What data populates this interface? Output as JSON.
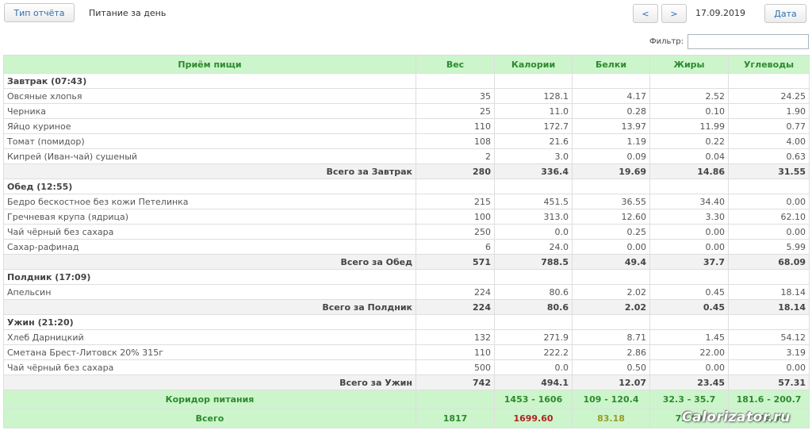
{
  "header": {
    "report_type_button": "Тип отчёта",
    "page_title": "Питание за день",
    "prev_button": "<",
    "next_button": ">",
    "current_date": "17.09.2019",
    "date_button": "Дата",
    "filter_label": "Фильтр:",
    "filter_value": ""
  },
  "table": {
    "columns": [
      "Приём пищи",
      "Вес",
      "Калории",
      "Белки",
      "Жиры",
      "Углеводы"
    ],
    "meals": [
      {
        "title": "Завтрак (07:43)",
        "items": [
          [
            "Овсяные хлопья",
            "35",
            "128.1",
            "4.17",
            "2.52",
            "24.25"
          ],
          [
            "Черника",
            "25",
            "11.0",
            "0.28",
            "0.10",
            "1.90"
          ],
          [
            "Яйцо куриное",
            "110",
            "172.7",
            "13.97",
            "11.99",
            "0.77"
          ],
          [
            "Томат (помидор)",
            "108",
            "21.6",
            "1.19",
            "0.22",
            "4.00"
          ],
          [
            "Кипрей (Иван-чай) сушеный",
            "2",
            "3.0",
            "0.09",
            "0.04",
            "0.63"
          ]
        ],
        "subtotal": [
          "Всего за Завтрак",
          "280",
          "336.4",
          "19.69",
          "14.86",
          "31.55"
        ]
      },
      {
        "title": "Обед (12:55)",
        "items": [
          [
            "Бедро бескостное без кожи Петелинка",
            "215",
            "451.5",
            "36.55",
            "34.40",
            "0.00"
          ],
          [
            "Гречневая крупа (ядрица)",
            "100",
            "313.0",
            "12.60",
            "3.30",
            "62.10"
          ],
          [
            "Чай чёрный без сахара",
            "250",
            "0.0",
            "0.25",
            "0.00",
            "0.00"
          ],
          [
            "Сахар-рафинад",
            "6",
            "24.0",
            "0.00",
            "0.00",
            "5.99"
          ]
        ],
        "subtotal": [
          "Всего за Обед",
          "571",
          "788.5",
          "49.4",
          "37.7",
          "68.09"
        ]
      },
      {
        "title": "Полдник (17:09)",
        "items": [
          [
            "Апельсин",
            "224",
            "80.6",
            "2.02",
            "0.45",
            "18.14"
          ]
        ],
        "subtotal": [
          "Всего за Полдник",
          "224",
          "80.6",
          "2.02",
          "0.45",
          "18.14"
        ]
      },
      {
        "title": "Ужин (21:20)",
        "items": [
          [
            "Хлеб Дарницкий",
            "132",
            "271.9",
            "8.71",
            "1.45",
            "54.12"
          ],
          [
            "Сметана Брест-Литовск 20% 315г",
            "110",
            "222.2",
            "2.86",
            "22.00",
            "3.19"
          ],
          [
            "Чай чёрный без сахара",
            "500",
            "0.0",
            "0.50",
            "0.00",
            "0.00"
          ]
        ],
        "subtotal": [
          "Всего за Ужин",
          "742",
          "494.1",
          "12.07",
          "23.45",
          "57.31"
        ]
      }
    ],
    "corridor": {
      "label": "Коридор питания",
      "weight": "",
      "kcal": "1453 - 1606",
      "protein": "109 - 120.4",
      "fat": "32.3 - 35.7",
      "carbs": "181.6 - 200.7"
    },
    "total": {
      "label": "Всего",
      "weight": "1817",
      "kcal": "1699.60",
      "protein": "83.18",
      "fat": "75.80",
      "carbs": "175.09"
    }
  },
  "watermark": "Calorizator.ru",
  "colors": {
    "header_bg": "#ccf5cc",
    "header_text": "#2d8a2d",
    "link_blue": "#2d6fb4",
    "over_limit_red": "#b22222",
    "under_limit_olive": "#9a9a26"
  }
}
